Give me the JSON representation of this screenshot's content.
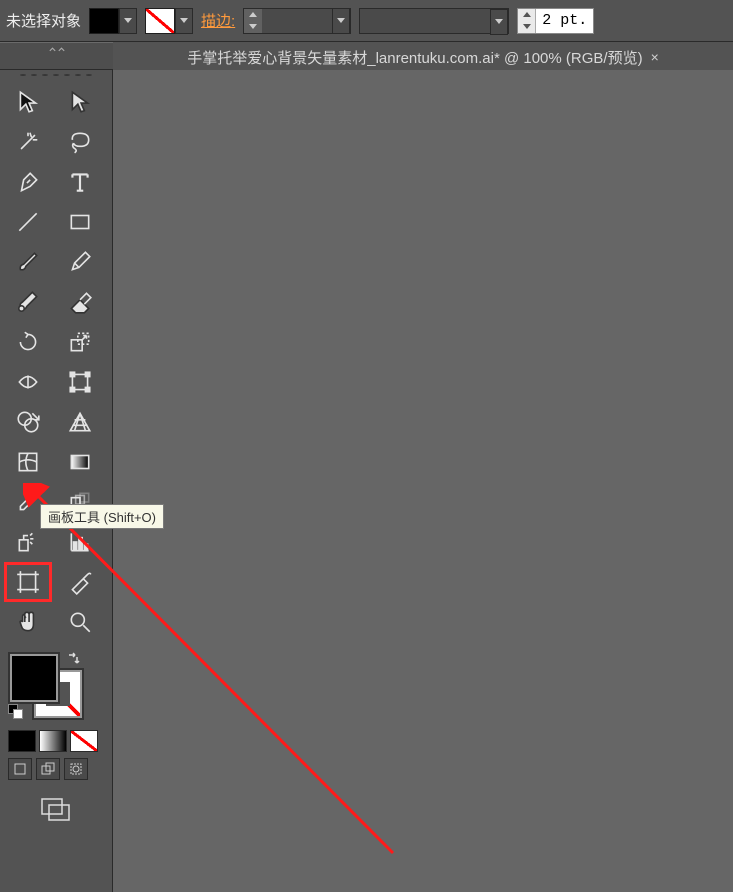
{
  "options_bar": {
    "selection_label": "未选择对象",
    "fill_color": "#000000",
    "stroke": "none",
    "stroke_section_label": "描边:",
    "stroke_weight_value": "",
    "stroke_weight_unit_field": "2 pt.",
    "variable_profile": "",
    "brush_def": ""
  },
  "document_tab": {
    "title": "手掌托举爱心背景矢量素材_lanrentuku.com.ai* @ 100% (RGB/预览)"
  },
  "tools": [
    {
      "name": "selection-tool"
    },
    {
      "name": "direct-selection-tool"
    },
    {
      "name": "magic-wand-tool"
    },
    {
      "name": "lasso-tool"
    },
    {
      "name": "pen-tool"
    },
    {
      "name": "type-tool"
    },
    {
      "name": "line-segment-tool"
    },
    {
      "name": "rectangle-tool"
    },
    {
      "name": "paintbrush-tool"
    },
    {
      "name": "pencil-tool"
    },
    {
      "name": "blob-brush-tool"
    },
    {
      "name": "eraser-tool"
    },
    {
      "name": "rotate-tool"
    },
    {
      "name": "scale-tool"
    },
    {
      "name": "width-tool"
    },
    {
      "name": "free-transform-tool"
    },
    {
      "name": "shape-builder-tool"
    },
    {
      "name": "perspective-grid-tool"
    },
    {
      "name": "mesh-tool"
    },
    {
      "name": "gradient-tool"
    },
    {
      "name": "eyedropper-tool"
    },
    {
      "name": "blend-tool"
    },
    {
      "name": "symbol-sprayer-tool"
    },
    {
      "name": "column-graph-tool"
    },
    {
      "name": "artboard-tool"
    },
    {
      "name": "slice-tool"
    },
    {
      "name": "hand-tool"
    },
    {
      "name": "zoom-tool"
    }
  ],
  "tooltip": {
    "text": "画板工具 (Shift+O)"
  },
  "color": {
    "fill": "#000000",
    "stroke": "none"
  },
  "draw_modes": [
    "normal",
    "behind",
    "inside"
  ],
  "screen_mode": "standard"
}
